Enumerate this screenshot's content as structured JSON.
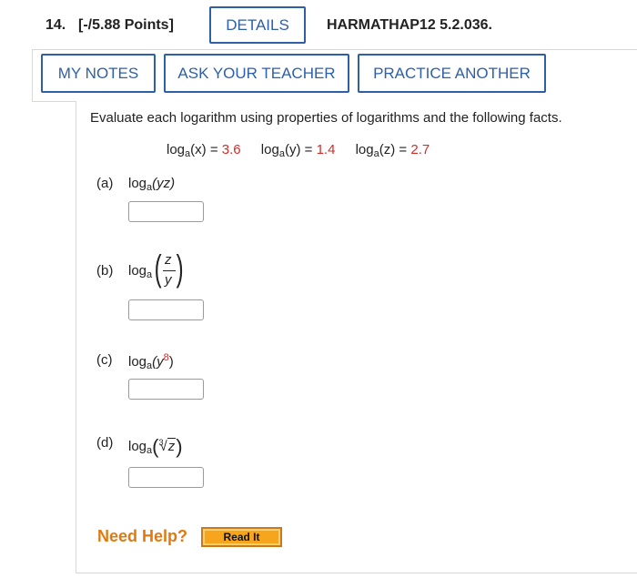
{
  "header": {
    "question_number": "14.",
    "points": "[-/5.88 Points]",
    "details_label": "DETAILS",
    "problem_code": "HARMATHAP12 5.2.036."
  },
  "toolbar": {
    "my_notes_label": "MY NOTES",
    "ask_teacher_label": "ASK YOUR TEACHER",
    "practice_another_label": "PRACTICE ANOTHER"
  },
  "question": {
    "prompt": "Evaluate each logarithm using properties of logarithms and the following facts.",
    "facts": [
      {
        "log": "log",
        "base": "a",
        "arg": "(x)",
        "eq": " = ",
        "value": "3.6"
      },
      {
        "log": "log",
        "base": "a",
        "arg": "(y)",
        "eq": " = ",
        "value": "1.4"
      },
      {
        "log": "log",
        "base": "a",
        "arg": "(z)",
        "eq": " = ",
        "value": "2.7"
      }
    ]
  },
  "parts": {
    "a": {
      "label": "(a)",
      "log": "log",
      "base": "a",
      "arg": "(yz)",
      "answer": ""
    },
    "b": {
      "label": "(b)",
      "log": "log",
      "base": "a",
      "num": "z",
      "den": "y",
      "answer": ""
    },
    "c": {
      "label": "(c)",
      "log": "log",
      "base": "a",
      "arg_open": "(y",
      "exponent": "8",
      "arg_close": ")",
      "answer": ""
    },
    "d": {
      "label": "(d)",
      "log": "log",
      "base": "a",
      "root_index": "3",
      "radicand": "z",
      "answer": ""
    }
  },
  "help": {
    "need_help": "Need Help?",
    "read_it": "Read It"
  },
  "colors": {
    "link_blue": "#2e5fa7",
    "value_red": "#d42b2b",
    "help_orange": "#e07a10",
    "read_it_bg": "#f6a51c"
  }
}
